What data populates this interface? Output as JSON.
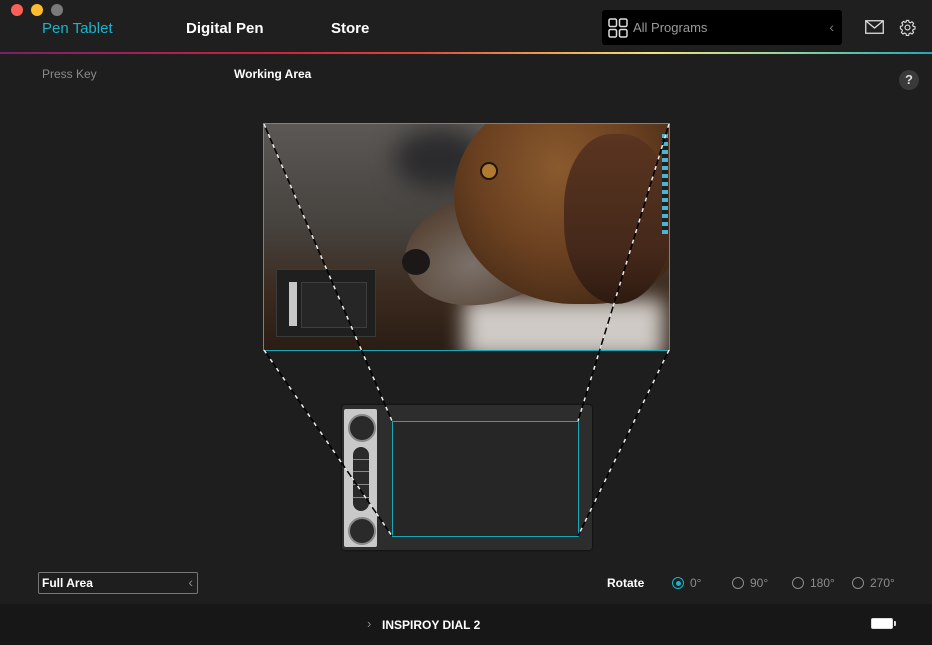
{
  "window": {
    "controls": [
      "close",
      "minimize",
      "zoom"
    ]
  },
  "nav": {
    "tabs": [
      {
        "label": "Pen Tablet",
        "active": true
      },
      {
        "label": "Digital Pen",
        "active": false
      },
      {
        "label": "Store",
        "active": false
      }
    ],
    "program_selector": {
      "label": "All Programs",
      "icon": "grid-icon"
    },
    "icons": [
      "mail-icon",
      "gear-icon"
    ]
  },
  "subtabs": [
    {
      "label": "Press Key",
      "active": false
    },
    {
      "label": "Working Area",
      "active": true
    }
  ],
  "help_label": "?",
  "colors": {
    "accent": "#1ab3c8",
    "background": "#1e1e1e",
    "footer": "#171717"
  },
  "working_area": {
    "mapping_mode": "Full Area",
    "rotate": {
      "label": "Rotate",
      "options": [
        "0°",
        "90°",
        "180°",
        "270°"
      ],
      "selected": "0°"
    }
  },
  "footer": {
    "device_name": "INSPIROY DIAL 2",
    "battery_icon": "battery-icon"
  }
}
